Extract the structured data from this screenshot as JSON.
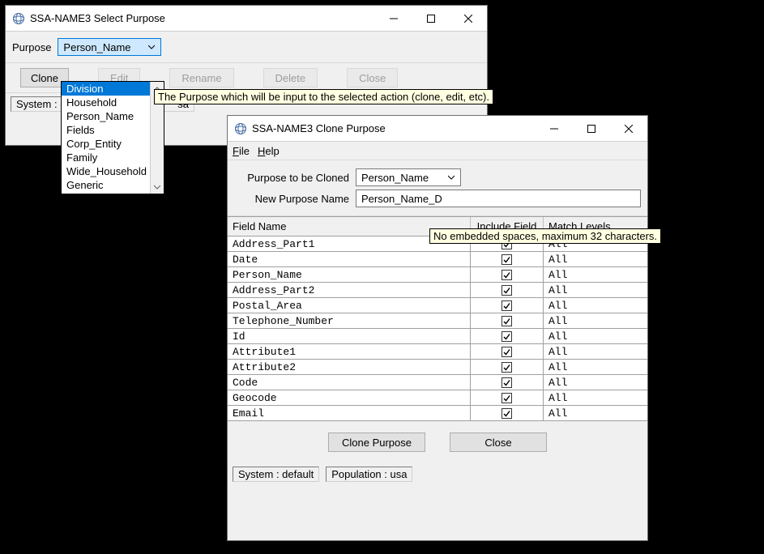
{
  "select_window": {
    "title": "SSA-NAME3 Select Purpose",
    "purpose_label": "Purpose",
    "purpose_value": "Person_Name",
    "dropdown_items": [
      "Division",
      "Household",
      "Person_Name",
      "Fields",
      "Corp_Entity",
      "Family",
      "Wide_Household",
      "Generic"
    ],
    "dropdown_selected_index": 0,
    "buttons": {
      "clone": "Clone",
      "edit": "Edit",
      "rename": "Rename",
      "delete": "Delete",
      "close": "Close"
    },
    "status_system_prefix": "System :",
    "status_population_visible": "sa",
    "tooltip_purpose": "The Purpose which will be input to the selected action (clone, edit, etc)."
  },
  "clone_window": {
    "title": "SSA-NAME3 Clone Purpose",
    "menu": {
      "file": "File",
      "help": "Help"
    },
    "label_to_clone": "Purpose to be Cloned",
    "value_to_clone": "Person_Name",
    "label_new_name": "New Purpose Name",
    "value_new_name": "Person_Name_D",
    "tooltip_newname": "No embedded spaces, maximum 32 characters.",
    "columns": {
      "field": "Field Name",
      "include": "Include Field",
      "match": "Match Levels"
    },
    "rows": [
      {
        "field": "Address_Part1",
        "include": true,
        "match": "All"
      },
      {
        "field": "Date",
        "include": true,
        "match": "All"
      },
      {
        "field": "Person_Name",
        "include": true,
        "match": "All"
      },
      {
        "field": "Address_Part2",
        "include": true,
        "match": "All"
      },
      {
        "field": "Postal_Area",
        "include": true,
        "match": "All"
      },
      {
        "field": "Telephone_Number",
        "include": true,
        "match": "All"
      },
      {
        "field": "Id",
        "include": true,
        "match": "All"
      },
      {
        "field": "Attribute1",
        "include": true,
        "match": "All"
      },
      {
        "field": "Attribute2",
        "include": true,
        "match": "All"
      },
      {
        "field": "Code",
        "include": true,
        "match": "All"
      },
      {
        "field": "Geocode",
        "include": true,
        "match": "All"
      },
      {
        "field": "Email",
        "include": true,
        "match": "All"
      }
    ],
    "buttons": {
      "clone": "Clone Purpose",
      "close": "Close"
    },
    "status_system": "System : default",
    "status_population": "Population : usa"
  }
}
